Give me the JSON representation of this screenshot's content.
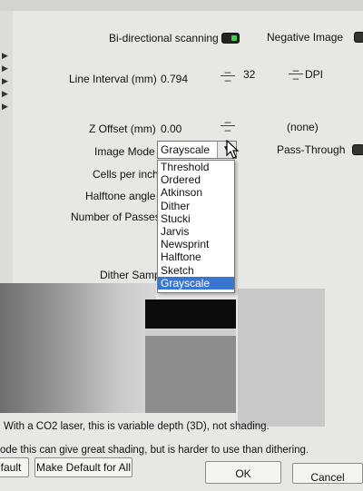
{
  "settings": {
    "bidirectional_label": "Bi-directional scanning",
    "negative_image_label": "Negative Image",
    "line_interval_label": "Line Interval (mm)",
    "line_interval_value": "0.794",
    "dpi_value": "32",
    "dpi_label": "DPI",
    "z_offset_label": "Z Offset (mm)",
    "z_offset_value": "0.00",
    "z_offset_note": "(none)",
    "image_mode_label": "Image Mode",
    "image_mode_value": "Grayscale",
    "pass_through_label": "Pass-Through",
    "cells_per_inch_label": "Cells per inch",
    "halftone_angle_label": "Halftone angle",
    "passes_label": "Number of Passes",
    "dither_sample_label": "Dither Samp"
  },
  "dropdown": {
    "options": [
      "Threshold",
      "Ordered",
      "Atkinson",
      "Dither",
      "Stucki",
      "Jarvis",
      "Newsprint",
      "Halftone",
      "Sketch",
      "Grayscale"
    ],
    "selected": "Grayscale"
  },
  "footer": {
    "line1": "With a CO2 laser, this is variable depth (3D), not shading.",
    "line2": "ode this can give great shading, but is harder to use than dithering."
  },
  "buttons": {
    "default": "fault",
    "make_default_all": "Make Default for All",
    "ok": "OK",
    "cancel": "Cancel"
  },
  "colors": {
    "toggle_on": "#3fd34b",
    "selection": "#3876d0",
    "background": "#e7e7e4"
  }
}
